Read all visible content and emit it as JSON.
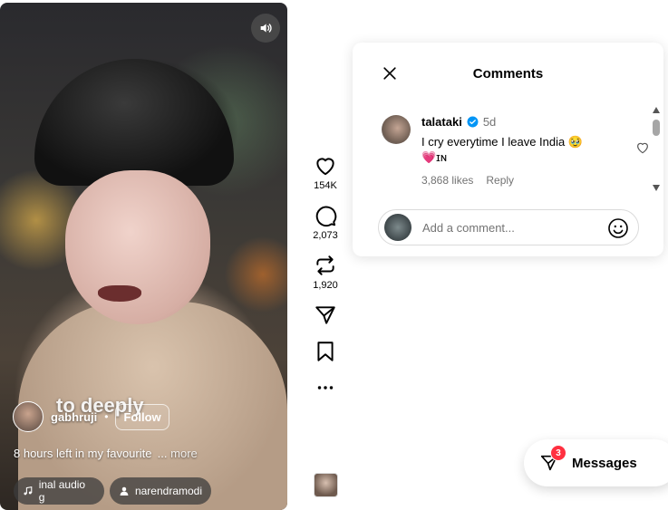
{
  "video": {
    "overlay_text": "to deeply",
    "author": {
      "username": "gabhruji",
      "separator": "•",
      "follow_label": "Follow"
    },
    "caption": "8 hours left in my favourite  ...",
    "more_label": "more",
    "audio_chip": "inal audio   g",
    "tagged_user_chip": "narendramodi"
  },
  "actions": {
    "likes": "154K",
    "comments": "2,073",
    "reposts": "1,920"
  },
  "comments_panel": {
    "title": "Comments",
    "comment": {
      "username": "talataki",
      "time": "5d",
      "text": "I cry everytime I leave India 🥹",
      "text_line2": "💗ɪɴ",
      "likes": "3,868 likes",
      "reply_label": "Reply"
    },
    "add_comment": {
      "placeholder": "Add a comment..."
    }
  },
  "messages": {
    "label": "Messages",
    "badge": "3"
  },
  "colors": {
    "verified": "#0095f6",
    "badge": "#ff3040"
  }
}
